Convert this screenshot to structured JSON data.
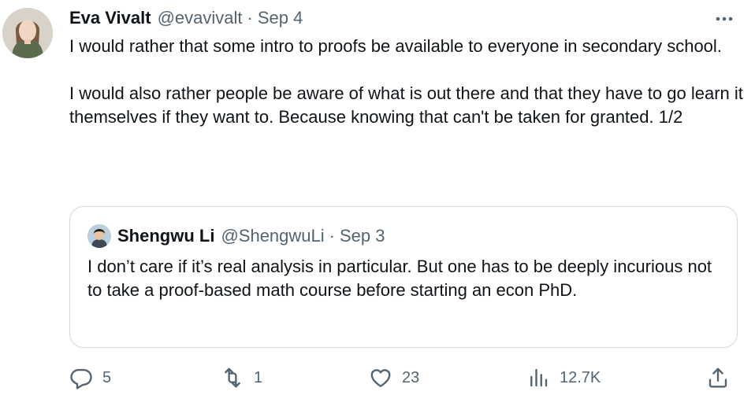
{
  "tweet": {
    "author_name": "Eva Vivalt",
    "handle": "@evavivalt",
    "separator": "·",
    "date": "Sep 4",
    "text": "I would rather that some intro to proofs be available to everyone in secondary school.\n\nI would also rather people be aware of what is out there and that they have to go learn it themselves if they want to. Because knowing that can't be taken for granted. 1/2"
  },
  "quote": {
    "author_name": "Shengwu Li",
    "handle": "@ShengwuLi",
    "separator": "·",
    "date": "Sep 3",
    "text": "I don’t care if it’s real analysis in particular. But one has to be deeply incurious not to take a proof-based math course before starting an econ PhD."
  },
  "actions": {
    "replies": "5",
    "reposts": "1",
    "likes": "23",
    "views": "12.7K"
  },
  "icons": {
    "more": "more-dots-icon",
    "reply": "reply-icon",
    "repost": "repost-icon",
    "like": "heart-icon",
    "views": "views-chart-icon",
    "share": "share-icon"
  },
  "colors": {
    "text_primary": "#0f1419",
    "text_secondary": "#536471",
    "border": "#cfd9de"
  }
}
